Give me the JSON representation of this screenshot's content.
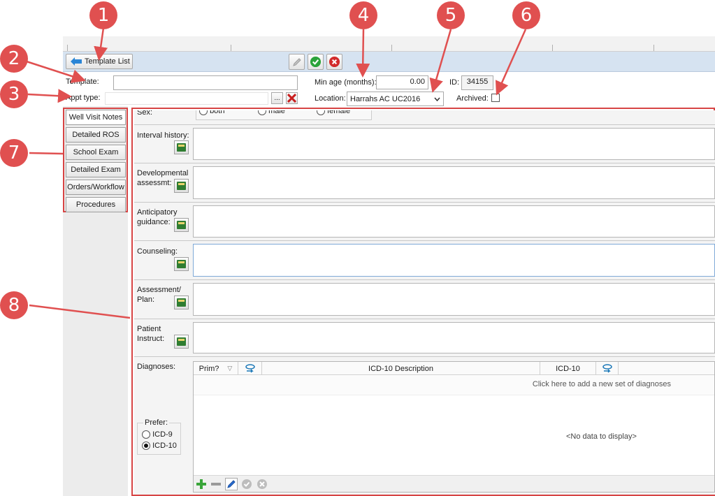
{
  "toolbar": {
    "template_list_label": "Template List"
  },
  "header": {
    "template_label": "Template:",
    "template_value": "",
    "appt_type_label": "Appt type:",
    "appt_type_value": "",
    "browse_label": "...",
    "min_age_label": "Min age (months):",
    "min_age_value": "0.00",
    "id_label": "ID:",
    "id_value": "34155",
    "location_label": "Location:",
    "location_value": "Harrahs AC UC2016",
    "archived_label": "Archived:"
  },
  "tabs": [
    {
      "label": "Well Visit Notes"
    },
    {
      "label": "Detailed ROS"
    },
    {
      "label": "School Exam"
    },
    {
      "label": "Detailed Exam"
    },
    {
      "label": "Orders/Workflow"
    },
    {
      "label": "Procedures"
    }
  ],
  "form": {
    "sex": {
      "label": "Sex:",
      "options": [
        "both",
        "male",
        "female"
      ]
    },
    "interval_history": {
      "label": "Interval history:"
    },
    "developmental": {
      "line1": "Developmental",
      "line2": "assessmt:"
    },
    "anticipatory": {
      "line1": "Anticipatory",
      "line2": "guidance:"
    },
    "counseling": {
      "label": "Counseling:"
    },
    "assessment": {
      "line1": "Assessment/",
      "line2": "Plan:"
    },
    "patient_instruct": {
      "line1": "Patient",
      "line2": "Instruct:"
    },
    "diagnoses": {
      "label": "Diagnoses:",
      "columns": {
        "prim": "Prim?",
        "description": "ICD-10 Description",
        "code": "ICD-10"
      },
      "add_hint": "Click here to add a new set of diagnoses",
      "empty_text": "<No data to display>",
      "prefer_label": "Prefer:",
      "prefer_options": [
        "ICD-9",
        "ICD-10"
      ],
      "prefer_selected": "ICD-10"
    }
  },
  "callouts": [
    "1",
    "2",
    "3",
    "4",
    "5",
    "6",
    "7",
    "8"
  ],
  "colors": {
    "callout": "#e05050",
    "toolbar": "#d6e3f1",
    "highlight_border": "#d74444"
  }
}
